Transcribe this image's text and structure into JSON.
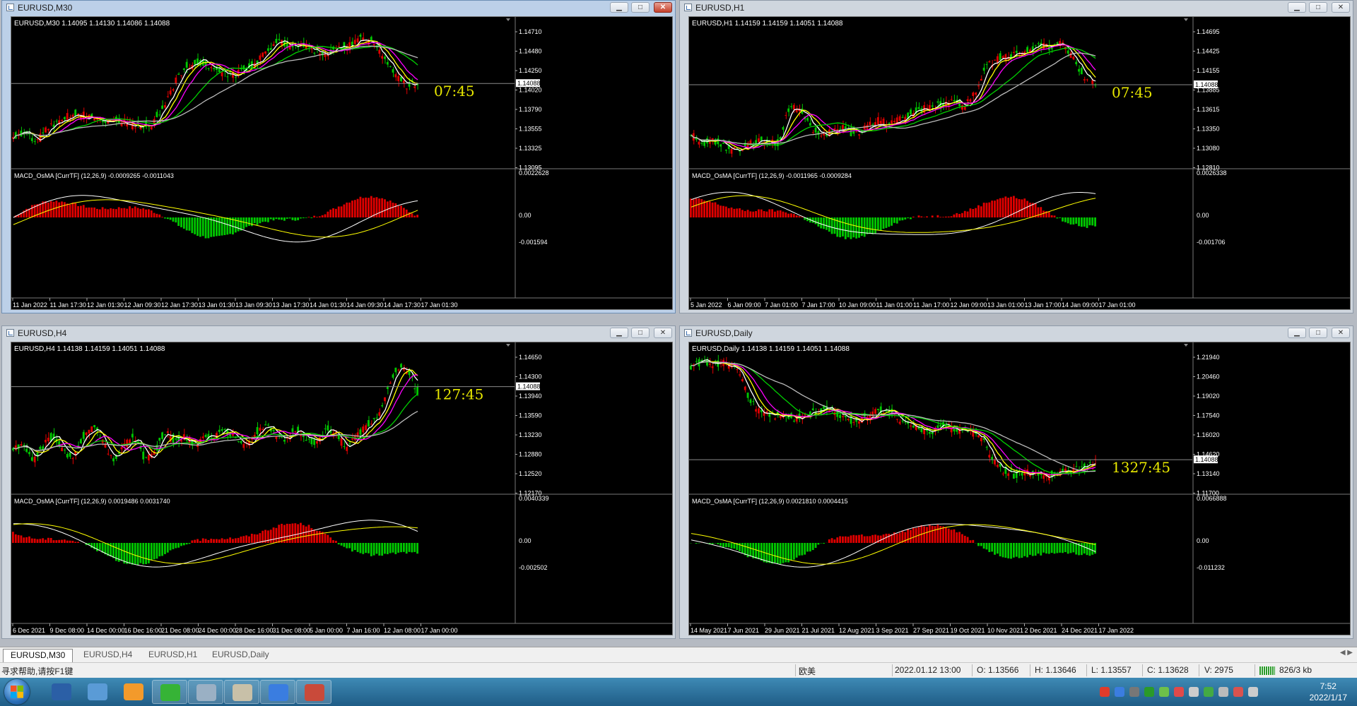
{
  "windows": [
    {
      "id": "m30",
      "title": "EURUSD,M30",
      "header": "EURUSD,M30  1.14095 1.14130 1.14086 1.14088",
      "price_scale": [
        "1.14710",
        "1.14480",
        "1.14250",
        "1.14020",
        "1.13790",
        "1.13555",
        "1.13325",
        "1.13095"
      ],
      "current_price": "1.14088",
      "timer": "07:45",
      "indicator_label": "MACD_OsMA [CurrTF] (12,26,9) -0.0009265 -0.0011043",
      "indicator_scale": [
        "0.0022628",
        "0.00",
        "-0.001594"
      ],
      "time_labels": [
        "11 Jan 2022",
        "11 Jan 17:30",
        "12 Jan 01:30",
        "12 Jan 09:30",
        "12 Jan 17:30",
        "13 Jan 01:30",
        "13 Jan 09:30",
        "13 Jan 17:30",
        "14 Jan 01:30",
        "14 Jan 09:30",
        "14 Jan 17:30",
        "17 Jan 01:30"
      ],
      "close_style": "red"
    },
    {
      "id": "h1",
      "title": "EURUSD,H1",
      "header": "EURUSD,H1  1.14159 1.14159 1.14051 1.14088",
      "price_scale": [
        "1.14695",
        "1.14425",
        "1.14155",
        "1.13885",
        "1.13615",
        "1.13350",
        "1.13080",
        "1.12810"
      ],
      "current_price": "1.14088",
      "timer": "07:45",
      "indicator_label": "MACD_OsMA [CurrTF] (12,26,9) -0.0011965 -0.0009284",
      "indicator_scale": [
        "0.0026338",
        "0.00",
        "-0.001706"
      ],
      "time_labels": [
        "5 Jan 2022",
        "6 Jan 09:00",
        "7 Jan 01:00",
        "7 Jan 17:00",
        "10 Jan 09:00",
        "11 Jan 01:00",
        "11 Jan 17:00",
        "12 Jan 09:00",
        "13 Jan 01:00",
        "13 Jan 17:00",
        "14 Jan 09:00",
        "17 Jan 01:00"
      ],
      "close_style": "normal"
    },
    {
      "id": "h4",
      "title": "EURUSD,H4",
      "header": "EURUSD,H4  1.14138 1.14159 1.14051 1.14088",
      "price_scale": [
        "1.14650",
        "1.14300",
        "1.13940",
        "1.13590",
        "1.13230",
        "1.12880",
        "1.12520",
        "1.12170"
      ],
      "current_price": "1.14088",
      "timer": "127:45",
      "indicator_label": "MACD_OsMA [CurrTF] (12,26,9) 0.0019486 0.0031740",
      "indicator_scale": [
        "0.0040339",
        "0.00",
        "-0.002502"
      ],
      "time_labels": [
        "6 Dec 2021",
        "9 Dec 08:00",
        "14 Dec 00:00",
        "16 Dec 16:00",
        "21 Dec 08:00",
        "24 Dec 00:00",
        "28 Dec 16:00",
        "31 Dec 08:00",
        "5 Jan 00:00",
        "7 Jan 16:00",
        "12 Jan 08:00",
        "17 Jan 00:00"
      ],
      "close_style": "normal"
    },
    {
      "id": "d1",
      "title": "EURUSD,Daily",
      "header": "EURUSD,Daily  1.14138 1.14159 1.14051 1.14088",
      "price_scale": [
        "1.21940",
        "1.20460",
        "1.19020",
        "1.17540",
        "1.16020",
        "1.14620",
        "1.13140",
        "1.11700"
      ],
      "current_price": "1.14088",
      "timer": "1327:45",
      "indicator_label": "MACD_OsMA [CurrTF] (12,26,9) 0.0021810 0.0004415",
      "indicator_scale": [
        "0.0066888",
        "0.00",
        "-0.011232"
      ],
      "time_labels": [
        "14 May 2021",
        "7 Jun 2021",
        "29 Jun 2021",
        "21 Jul 2021",
        "12 Aug 2021",
        "3 Sep 2021",
        "27 Sep 2021",
        "19 Oct 2021",
        "10 Nov 2021",
        "2 Dec 2021",
        "24 Dec 2021",
        "17 Jan 2022"
      ],
      "close_style": "normal"
    }
  ],
  "tabs": [
    "EURUSD,M30",
    "EURUSD,H4",
    "EURUSD,H1",
    "EURUSD,Daily"
  ],
  "status": {
    "help": "寻求帮助,请按F1键",
    "profile": "欧美",
    "datetime": "2022.01.12 13:00",
    "open": "O: 1.13566",
    "high": "H: 1.13646",
    "low": "L: 1.13557",
    "close": "C: 1.13628",
    "volume": "V: 2975",
    "traffic": "826/3 kb"
  },
  "clock": {
    "time": "7:52",
    "date": "2022/1/17"
  },
  "colors": {
    "bull": "#00c800",
    "bear": "#e00000",
    "ma_fast": "#ffffff",
    "ma_yellow": "#ffff00",
    "ma_magenta": "#ff00ff",
    "ma_green": "#00d000",
    "ma_slow": "#bbbbbb",
    "timer": "#e8e800"
  },
  "taskbar_icons": [
    "desktop-icon",
    "network-icon",
    "app-orange-icon",
    "wechat-icon",
    "notepad-icon",
    "window-icon",
    "pen-icon",
    "mt4-icon"
  ]
}
